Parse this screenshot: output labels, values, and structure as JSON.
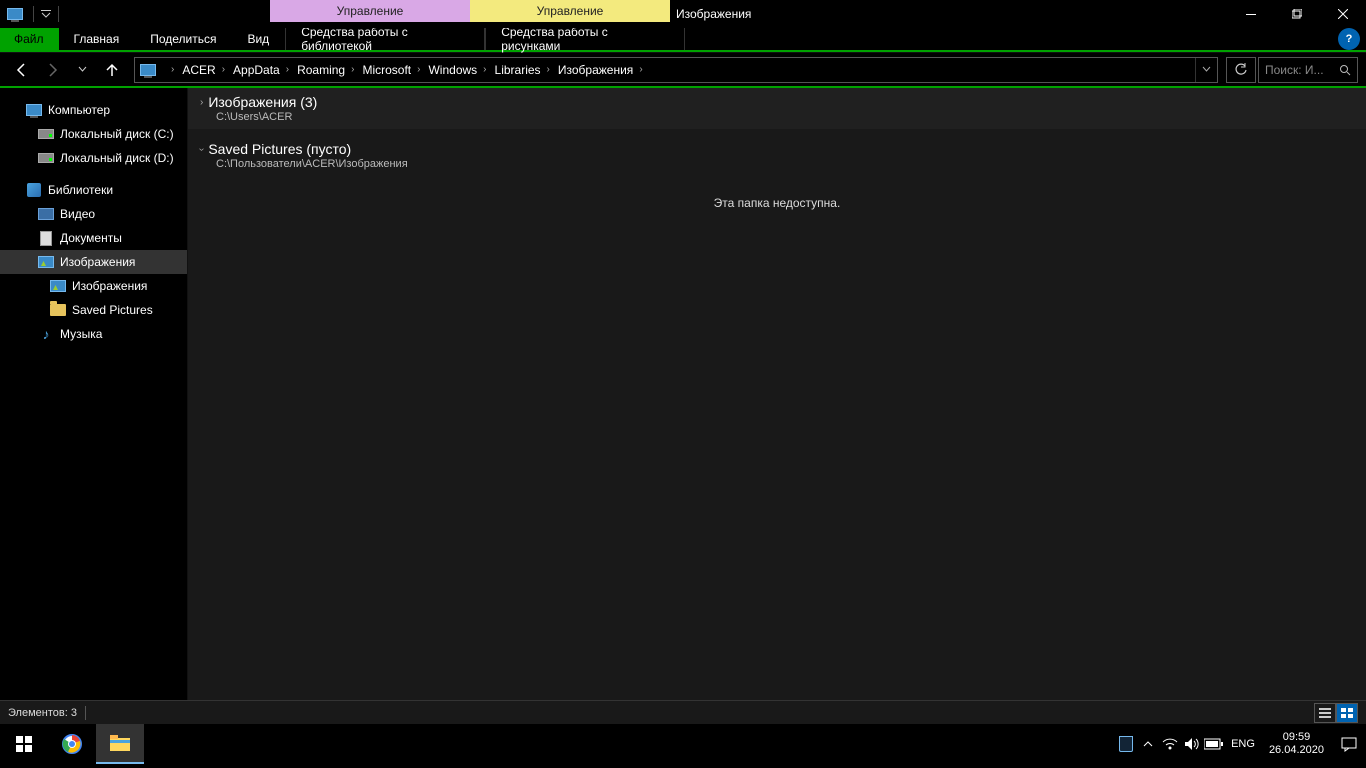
{
  "titlebar": {
    "ctx_lib": "Управление",
    "ctx_pic": "Управление",
    "title": "Изображения"
  },
  "ribbon": {
    "file": "Файл",
    "tabs": [
      "Главная",
      "Поделиться",
      "Вид",
      "Средства работы с библиотекой",
      "Средства работы с рисунками"
    ]
  },
  "breadcrumb": [
    "ACER",
    "AppData",
    "Roaming",
    "Microsoft",
    "Windows",
    "Libraries",
    "Изображения"
  ],
  "search_placeholder": "Поиск: И...",
  "sidebar": {
    "computer": "Компьютер",
    "drive_c": "Локальный диск (C:)",
    "drive_d": "Локальный диск (D:)",
    "libraries": "Библиотеки",
    "video": "Видео",
    "documents": "Документы",
    "pictures": "Изображения",
    "pictures_sub": "Изображения",
    "saved_pictures": "Saved Pictures",
    "music": "Музыка"
  },
  "content": {
    "group1_title": "Изображения (3)",
    "group1_path": "C:\\Users\\ACER",
    "group2_title": "Saved Pictures (пусто)",
    "group2_path": "C:\\Пользователи\\ACER\\Изображения",
    "unavailable": "Эта папка недоступна."
  },
  "statusbar": {
    "items": "Элементов: 3"
  },
  "taskbar": {
    "lang": "ENG",
    "time": "09:59",
    "date": "26.04.2020"
  }
}
